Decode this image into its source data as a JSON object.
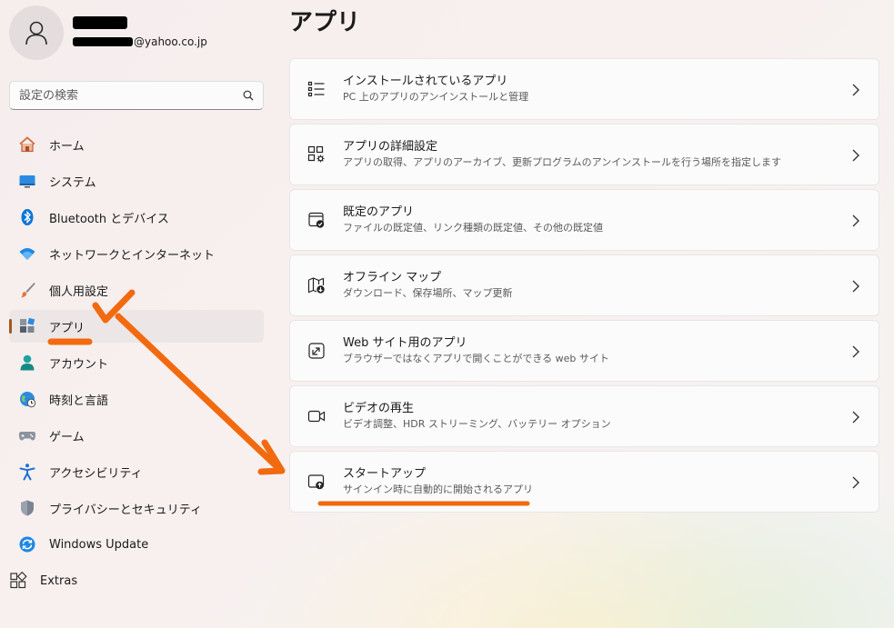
{
  "user": {
    "email_suffix": "@yahoo.co.jp"
  },
  "search": {
    "placeholder": "設定の検索"
  },
  "sidebar": {
    "items": [
      {
        "label": "ホーム",
        "icon": "home-icon"
      },
      {
        "label": "システム",
        "icon": "system-icon"
      },
      {
        "label": "Bluetooth とデバイス",
        "icon": "bluetooth-icon"
      },
      {
        "label": "ネットワークとインターネット",
        "icon": "wifi-icon"
      },
      {
        "label": "個人用設定",
        "icon": "brush-icon"
      },
      {
        "label": "アプリ",
        "icon": "apps-icon",
        "active": true
      },
      {
        "label": "アカウント",
        "icon": "account-icon"
      },
      {
        "label": "時刻と言語",
        "icon": "time-language-icon"
      },
      {
        "label": "ゲーム",
        "icon": "gamepad-icon"
      },
      {
        "label": "アクセシビリティ",
        "icon": "accessibility-icon"
      },
      {
        "label": "プライバシーとセキュリティ",
        "icon": "shield-icon"
      },
      {
        "label": "Windows Update",
        "icon": "update-icon"
      },
      {
        "label": "Extras",
        "icon": "extras-icon"
      }
    ]
  },
  "main": {
    "title": "アプリ",
    "cards": [
      {
        "title": "インストールされているアプリ",
        "description": "PC 上のアプリのアンインストールと管理",
        "icon": "list-icon"
      },
      {
        "title": "アプリの詳細設定",
        "description": "アプリの取得、アプリのアーカイブ、更新プログラムのアンインストールを行う場所を指定します",
        "icon": "app-settings-icon"
      },
      {
        "title": "既定のアプリ",
        "description": "ファイルの既定値、リンク種類の既定値、その他の既定値",
        "icon": "default-apps-icon"
      },
      {
        "title": "オフライン マップ",
        "description": "ダウンロード、保存場所、マップ更新",
        "icon": "map-icon"
      },
      {
        "title": "Web サイト用のアプリ",
        "description": "ブラウザーではなくアプリで開くことができる web サイト",
        "icon": "open-external-icon"
      },
      {
        "title": "ビデオの再生",
        "description": "ビデオ調整、HDR ストリーミング、バッテリー オプション",
        "icon": "video-icon"
      },
      {
        "title": "スタートアップ",
        "description": "サインイン時に自動的に開始されるアプリ",
        "icon": "startup-icon"
      }
    ]
  },
  "colors": {
    "annotation": "#f26a0f",
    "active_indicator": "#a35a1e",
    "accent_blue": "#0a74da"
  }
}
